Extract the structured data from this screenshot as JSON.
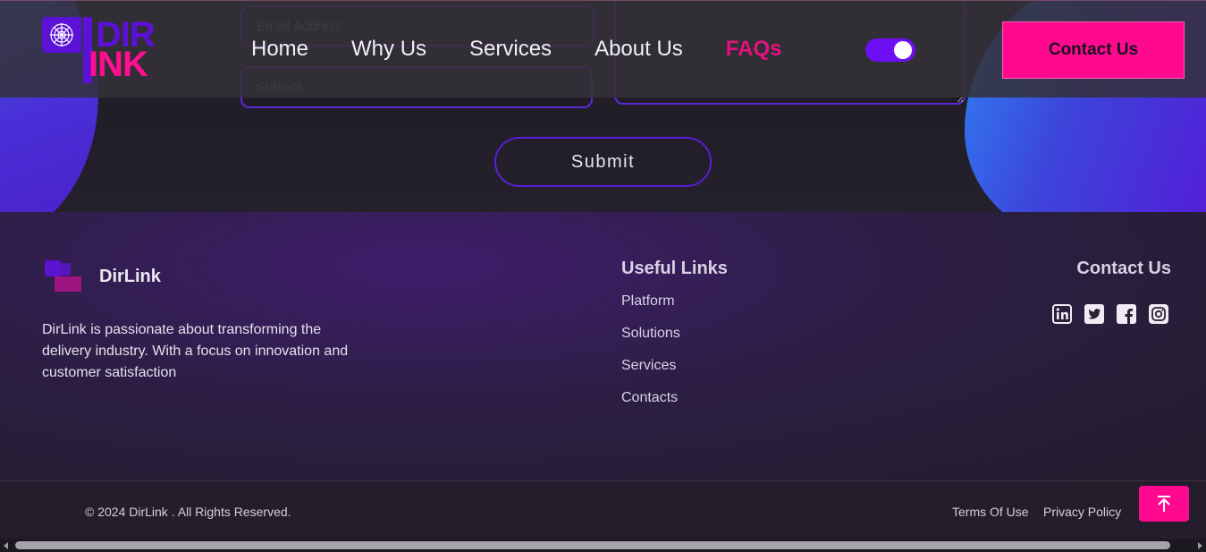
{
  "form": {
    "email_placeholder": "Email Address",
    "subject_placeholder": "Subject",
    "message_placeholder": "",
    "submit_label": "Submit"
  },
  "header": {
    "logo_top": "DIR",
    "logo_bottom": "INK",
    "nav": [
      {
        "label": "Home"
      },
      {
        "label": "Why Us"
      },
      {
        "label": "Services"
      },
      {
        "label": "About Us"
      },
      {
        "label": "FAQs",
        "active": true
      }
    ],
    "theme_toggle_on": true,
    "contact_button": "Contact Us"
  },
  "footer": {
    "brand_name": "DirLink",
    "about": "DirLink is passionate about transforming the delivery industry. With a focus on innovation and customer satisfaction",
    "links_title": "Useful Links",
    "links": [
      {
        "label": "Platform"
      },
      {
        "label": "Solutions"
      },
      {
        "label": "Services"
      },
      {
        "label": "Contacts"
      }
    ],
    "contact_title": "Contact Us",
    "socials": [
      "linkedin-icon",
      "twitter-icon",
      "facebook-icon",
      "instagram-icon"
    ]
  },
  "bottom": {
    "copyright": "© 2024 DirLink . All Rights Reserved.",
    "terms": "Terms Of Use",
    "privacy": "Privacy Policy",
    "to_top_icon": "arrow-up-to-top-icon"
  },
  "colors": {
    "accent_pink": "#ff0a8f",
    "accent_purple": "#6d0ff2"
  }
}
